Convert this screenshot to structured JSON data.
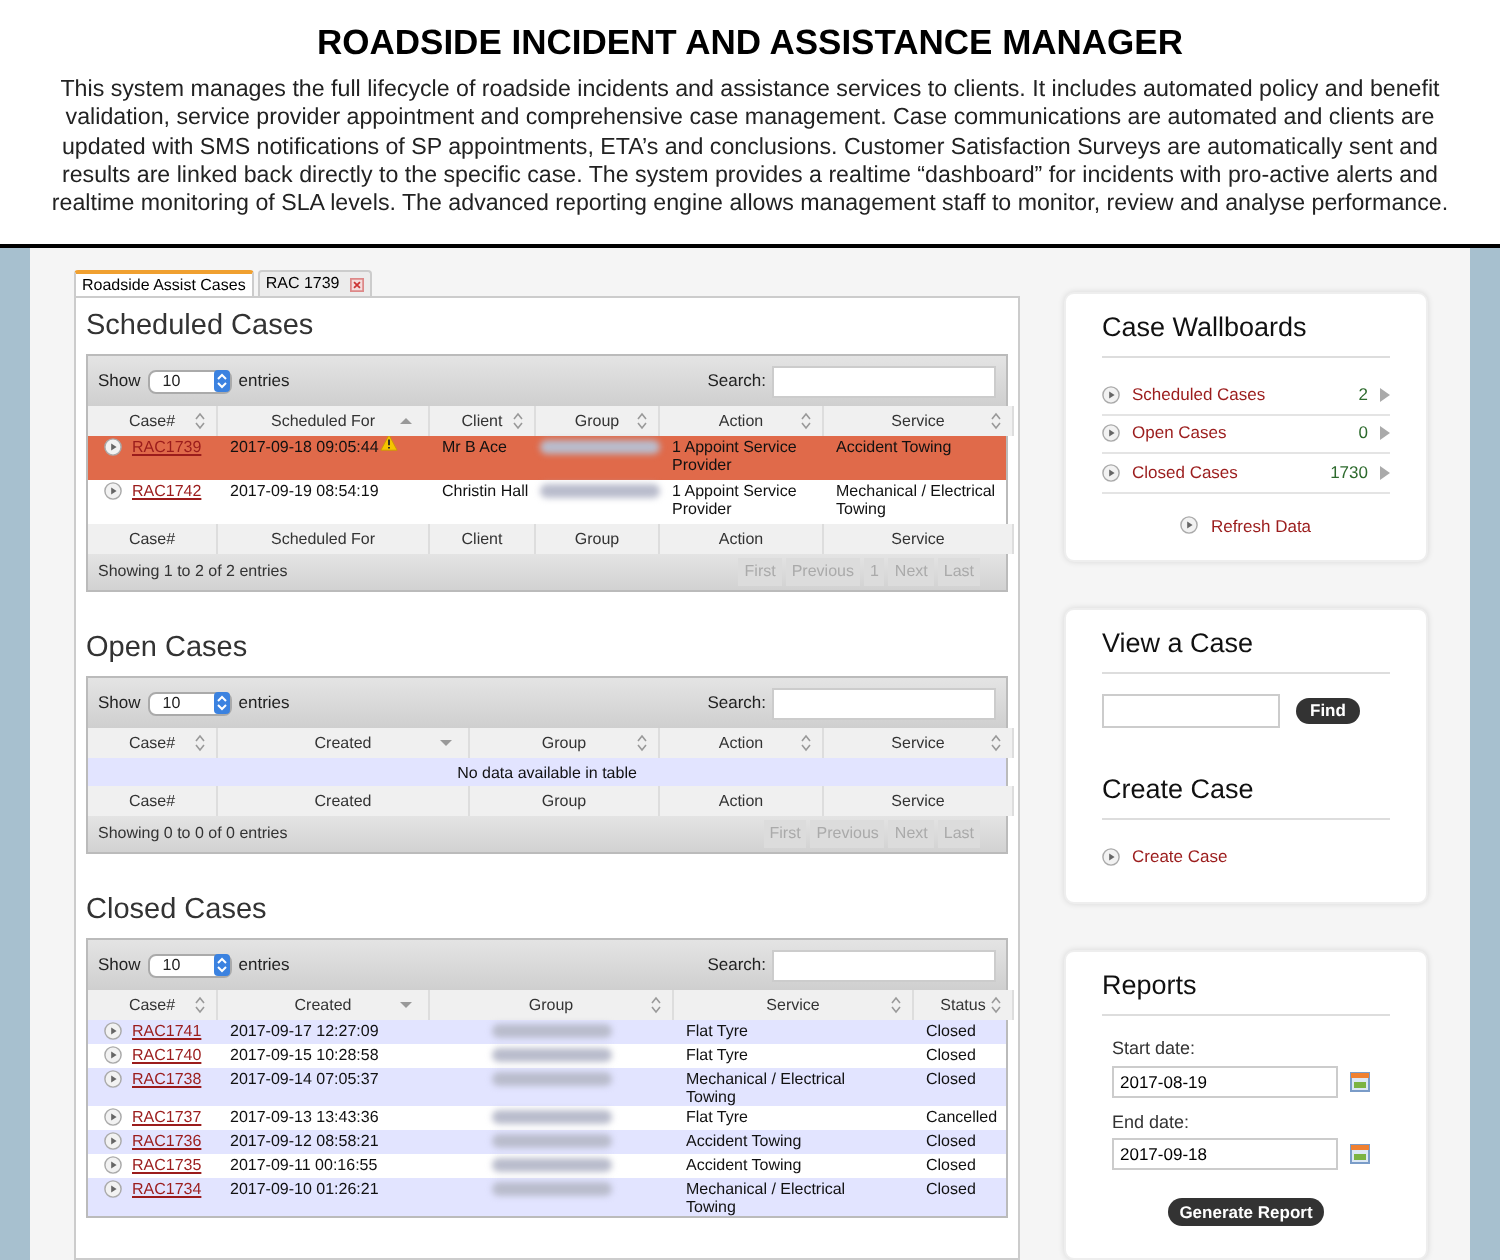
{
  "header": {
    "title": "ROADSIDE INCIDENT AND ASSISTANCE MANAGER",
    "description": "This system manages the full lifecycle of roadside incidents and assistance services to clients.  It includes automated policy and benefit validation, service provider appointment and comprehensive case management.  Case communications are automated and clients are updated with SMS notifications of SP appointments, ETA’s and conclusions. Customer Satisfaction Surveys are automatically sent and results are linked back directly to the specific case.  The system provides a realtime “dashboard” for incidents with pro-active alerts and realtime monitoring of SLA levels. The advanced reporting engine allows management staff to monitor, review and analyse performance."
  },
  "tabs": [
    {
      "label": "Roadside Assist Cases",
      "selected": true,
      "closable": false
    },
    {
      "label": "RAC 1739",
      "selected": false,
      "closable": true
    }
  ],
  "sections": [
    {
      "title": "Scheduled Cases",
      "show_label": "Show",
      "page_size": "10",
      "entries_label": "entries",
      "search_label": "Search:",
      "columns": [
        {
          "label": "Case#",
          "kind": "link",
          "sorted_asc": false,
          "sorted_desc": false
        },
        {
          "label": "Scheduled For",
          "kind": "text",
          "sorted_asc": true,
          "sorted_desc": false
        },
        {
          "label": "Client",
          "kind": "text",
          "sorted_asc": false,
          "sorted_desc": false
        },
        {
          "label": "Group",
          "kind": "redacted",
          "sorted_asc": false,
          "sorted_desc": false
        },
        {
          "label": "Action",
          "kind": "text",
          "sorted_asc": false,
          "sorted_desc": false
        },
        {
          "label": "Service",
          "kind": "text",
          "sorted_asc": false,
          "sorted_desc": false
        }
      ],
      "rows": [
        {
          "highlighted": true,
          "warning": true,
          "cells": [
            "RAC1739",
            "2017-09-18 09:05:44",
            "Mr B Ace",
            null,
            "1 Appoint Service Provider",
            "Accident Towing"
          ]
        },
        {
          "highlighted": false,
          "warning": false,
          "cells": [
            "RAC1742",
            "2017-09-19 08:54:19",
            "Christin Hall",
            null,
            "1 Appoint Service Provider",
            "Mechanical / Electrical Towing"
          ]
        }
      ],
      "footer_columns": [
        "Case#",
        "Scheduled For",
        "Client",
        "Group",
        "Action",
        "Service"
      ],
      "info": "Showing 1 to 2 of 2 entries",
      "pager": [
        {
          "label": "First",
          "disabled": true
        },
        {
          "label": "Previous",
          "disabled": true
        },
        {
          "label": "1",
          "disabled": true
        },
        {
          "label": "Next",
          "disabled": true
        },
        {
          "label": "Last",
          "disabled": true
        }
      ]
    },
    {
      "title": "Open Cases",
      "show_label": "Show",
      "page_size": "10",
      "entries_label": "entries",
      "search_label": "Search:",
      "columns": [
        {
          "label": "Case#",
          "sorted_asc": false,
          "sorted_desc": false
        },
        {
          "label": "Created",
          "sorted_asc": false,
          "sorted_desc": true
        },
        {
          "label": "Group",
          "sorted_asc": false,
          "sorted_desc": false
        },
        {
          "label": "Action",
          "sorted_asc": false,
          "sorted_desc": false
        },
        {
          "label": "Service",
          "sorted_asc": false,
          "sorted_desc": false
        }
      ],
      "empty_message": "No data available in table",
      "footer_columns": [
        "Case#",
        "Created",
        "Group",
        "Action",
        "Service"
      ],
      "info": "Showing 0 to 0 of 0 entries",
      "pager": [
        {
          "label": "First",
          "disabled": true
        },
        {
          "label": "Previous",
          "disabled": true
        },
        {
          "label": "Next",
          "disabled": true
        },
        {
          "label": "Last",
          "disabled": true
        }
      ]
    },
    {
      "title": "Closed Cases",
      "show_label": "Show",
      "page_size": "10",
      "entries_label": "entries",
      "search_label": "Search:",
      "columns": [
        {
          "label": "Case#",
          "kind": "link",
          "sorted_asc": false,
          "sorted_desc": false
        },
        {
          "label": "Created",
          "kind": "text",
          "sorted_asc": false,
          "sorted_desc": true
        },
        {
          "label": "Group",
          "kind": "redacted",
          "sorted_asc": false,
          "sorted_desc": false
        },
        {
          "label": "Service",
          "kind": "text",
          "sorted_asc": false,
          "sorted_desc": false
        },
        {
          "label": "Status",
          "kind": "text",
          "sorted_asc": false,
          "sorted_desc": false
        }
      ],
      "rows": [
        {
          "highlighted": false,
          "warning": false,
          "cells": [
            "RAC1741",
            "2017-09-17 12:27:09",
            null,
            "Flat Tyre",
            "Closed"
          ]
        },
        {
          "highlighted": false,
          "warning": false,
          "cells": [
            "RAC1740",
            "2017-09-15 10:28:58",
            null,
            "Flat Tyre",
            "Closed"
          ]
        },
        {
          "highlighted": false,
          "warning": false,
          "cells": [
            "RAC1738",
            "2017-09-14 07:05:37",
            null,
            "Mechanical / Electrical Towing",
            "Closed"
          ]
        },
        {
          "highlighted": false,
          "warning": false,
          "cells": [
            "RAC1737",
            "2017-09-13 13:43:36",
            null,
            "Flat Tyre",
            "Cancelled"
          ]
        },
        {
          "highlighted": false,
          "warning": false,
          "cells": [
            "RAC1736",
            "2017-09-12 08:58:21",
            null,
            "Accident Towing",
            "Closed"
          ]
        },
        {
          "highlighted": false,
          "warning": false,
          "cells": [
            "RAC1735",
            "2017-09-11 00:16:55",
            null,
            "Accident Towing",
            "Closed"
          ]
        },
        {
          "highlighted": false,
          "warning": false,
          "cells": [
            "RAC1734",
            "2017-09-10 01:26:21",
            null,
            "Mechanical / Electrical Towing",
            "Closed"
          ]
        }
      ]
    }
  ],
  "wallboards": {
    "title": "Case Wallboards",
    "items": [
      {
        "label": "Scheduled Cases",
        "count": "2"
      },
      {
        "label": "Open Cases",
        "count": "0"
      },
      {
        "label": "Closed Cases",
        "count": "1730"
      }
    ],
    "refresh": "Refresh Data"
  },
  "view_case": {
    "title": "View a Case",
    "button": "Find"
  },
  "create_case": {
    "title": "Create Case",
    "link": "Create Case"
  },
  "reports": {
    "title": "Reports",
    "fields": [
      {
        "label": "Start date:",
        "value": "2017-08-19"
      },
      {
        "label": "End date:",
        "value": "2017-09-18"
      }
    ],
    "button": "Generate Report"
  }
}
